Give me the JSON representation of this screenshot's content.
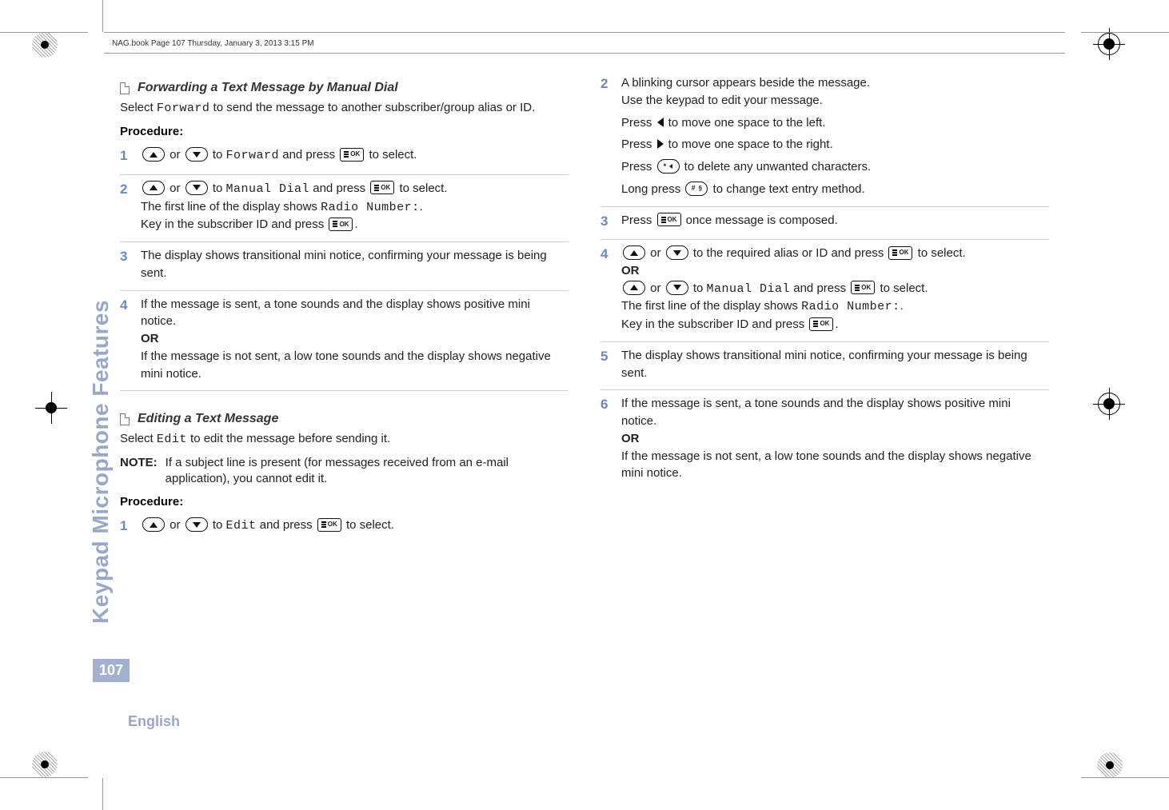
{
  "header": "NAG.book  Page 107  Thursday, January 3, 2013  3:15 PM",
  "sidetab": "Keypad Microphone Features",
  "page_number": "107",
  "language": "English",
  "left": {
    "heading1": "Forwarding a Text Message by Manual Dial",
    "intro1_a": "Select ",
    "intro1_mono": "Forward",
    "intro1_b": " to send the message to another subscriber/group alias or ID.",
    "procedure_label": "Procedure:",
    "steps1": {
      "s1_a": " or ",
      "s1_b": " to ",
      "s1_mono": "Forward",
      "s1_c": " and press ",
      "s1_d": " to select.",
      "s2_a": " or ",
      "s2_b": " to ",
      "s2_mono": "Manual Dial",
      "s2_c": " and press ",
      "s2_d": " to select.",
      "s2_line2a": "The first line of the display shows ",
      "s2_line2mono": "Radio Number:",
      "s2_line2b": ".",
      "s2_line3a": "Key in the subscriber ID and press ",
      "s2_line3b": ".",
      "s3": "The display shows transitional mini notice, confirming your message is being sent.",
      "s4a": "If the message is sent, a tone sounds and the display shows positive mini notice.",
      "s4_or": "OR",
      "s4b": "If the message is not sent, a low tone sounds and the display shows negative mini notice."
    },
    "heading2": "Editing a Text Message",
    "intro2_a": "Select ",
    "intro2_mono": "Edit",
    "intro2_b": " to edit the message before sending it.",
    "note_label": "NOTE:",
    "note_text": "If a subject line is present (for messages received from an e-mail application), you cannot edit it.",
    "steps2": {
      "s1_a": " or ",
      "s1_b": " to ",
      "s1_mono": "Edit",
      "s1_c": " and press ",
      "s1_d": " to select."
    }
  },
  "right": {
    "s2_l1": "A blinking cursor appears beside the message.",
    "s2_l2": "Use the keypad to edit your message.",
    "s2_l3a": "Press ",
    "s2_l3b": " to move one space to the left.",
    "s2_l4a": "Press ",
    "s2_l4b": " to move one space to the right.",
    "s2_l5a": "Press ",
    "s2_l5b": " to delete any unwanted characters.",
    "s2_l6a": "Long press ",
    "s2_l6b": " to change text entry method.",
    "s3a": "Press ",
    "s3b": " once message is composed.",
    "s4_l1a": " or ",
    "s4_l1b": " to the required alias or ID and press ",
    "s4_l1c": " to select.",
    "s4_or": "OR",
    "s4_l2a": " or ",
    "s4_l2b": " to ",
    "s4_l2mono": "Manual Dial",
    "s4_l2c": " and press ",
    "s4_l2d": " to select.",
    "s4_l3a": "The first line of the display shows ",
    "s4_l3mono": "Radio Number:",
    "s4_l3b": ".",
    "s4_l4a": "Key in the subscriber ID and press ",
    "s4_l4b": ".",
    "s5": "The display shows transitional mini notice, confirming your message is being sent.",
    "s6a": "If the message is sent, a tone sounds and the display shows positive mini notice.",
    "s6_or": "OR",
    "s6b": "If the message is not sent, a low tone sounds and the display shows negative mini notice."
  },
  "nums": {
    "n1": "1",
    "n2": "2",
    "n3": "3",
    "n4": "4",
    "n5": "5",
    "n6": "6"
  },
  "keys": {
    "ok": "OK",
    "star": "*",
    "hash": "#"
  }
}
